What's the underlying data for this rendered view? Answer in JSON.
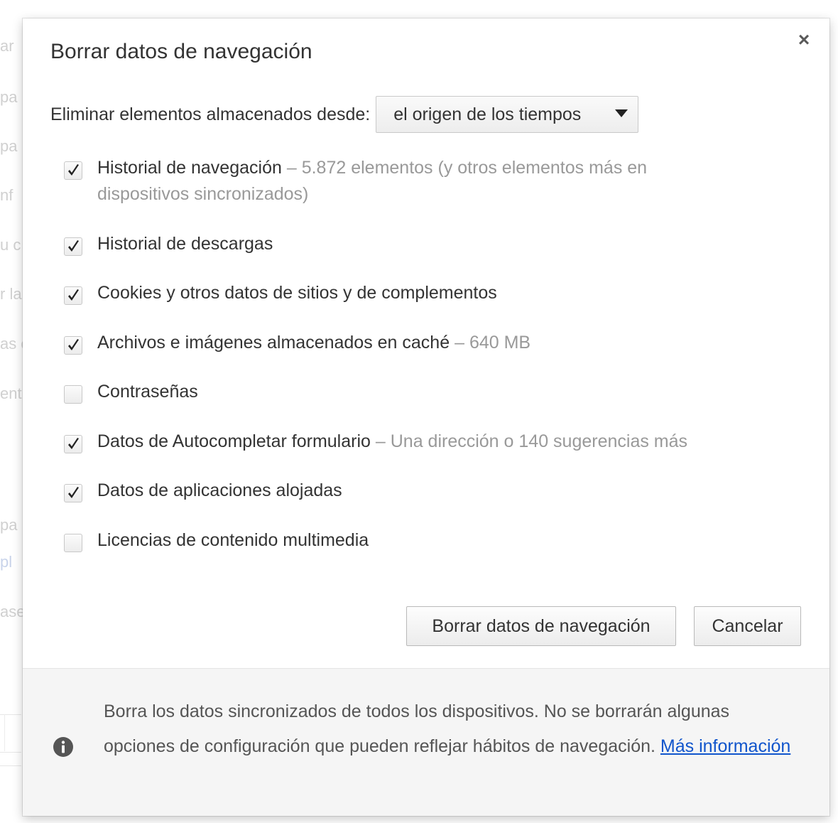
{
  "background": {
    "fragments": [
      "ar",
      "pa",
      "pa",
      "nf",
      "u c",
      "r la",
      "as c",
      "ent",
      "pa",
      "pl",
      "ase"
    ]
  },
  "dialog": {
    "title": "Borrar datos de navegación",
    "close_glyph": "×",
    "time_range": {
      "label": "Eliminar elementos almacenados desde:",
      "selected": "el origen de los tiempos"
    },
    "options": [
      {
        "label": "Historial de navegación",
        "separator": "–",
        "detail": "5.872 elementos (y otros elementos más en dispositivos sincronizados)",
        "checked": true
      },
      {
        "label": "Historial de descargas",
        "separator": "",
        "detail": "",
        "checked": true
      },
      {
        "label": "Cookies y otros datos de sitios y de complementos",
        "separator": "",
        "detail": "",
        "checked": true
      },
      {
        "label": "Archivos e imágenes almacenados en caché",
        "separator": "–",
        "detail": "640 MB",
        "checked": true
      },
      {
        "label": "Contraseñas",
        "separator": "",
        "detail": "",
        "checked": false
      },
      {
        "label": "Datos de Autocompletar formulario",
        "separator": "–",
        "detail": "Una dirección o 140 sugerencias más",
        "checked": true
      },
      {
        "label": "Datos de aplicaciones alojadas",
        "separator": "",
        "detail": "",
        "checked": true
      },
      {
        "label": "Licencias de contenido multimedia",
        "separator": "",
        "detail": "",
        "checked": false
      }
    ],
    "buttons": {
      "clear_label": "Borrar datos de navegación",
      "cancel_label": "Cancelar"
    },
    "footer": {
      "icon": "info-icon",
      "text": "Borra los datos sincronizados de todos los dispositivos. No se borrarán algunas opciones de configuración que pueden reflejar hábitos de navegación.",
      "link": "Más información"
    }
  },
  "colors": {
    "link": "#1155cc",
    "muted_text": "#999999",
    "text": "#333333",
    "footer_bg": "#f5f5f5"
  }
}
